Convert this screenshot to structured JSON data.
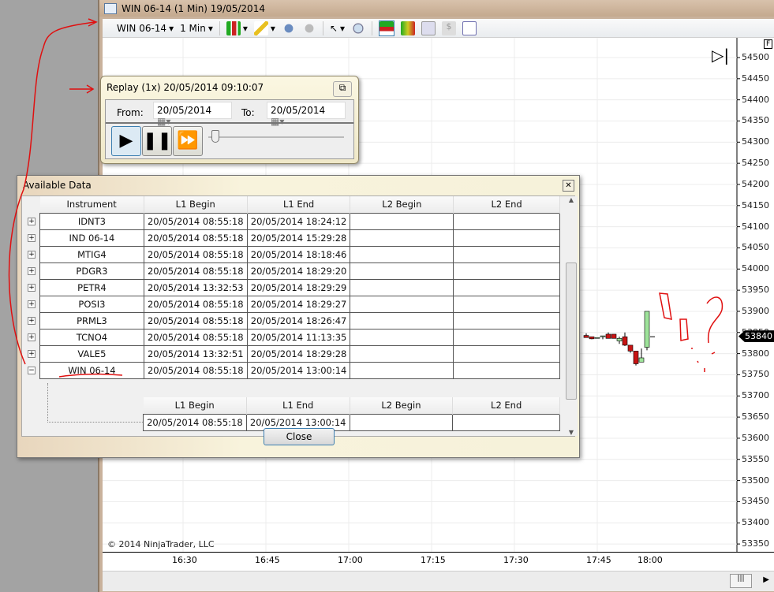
{
  "window": {
    "title": "WIN 06-14 (1 Min)  19/05/2014"
  },
  "toolbar": {
    "instrument": "WIN 06-14",
    "interval": "1 Min",
    "icons": [
      "bar-style-icon",
      "pencil-draw-icon",
      "add-indicator-icon",
      "remove-indicator-icon",
      "pointer-icon",
      "zoom-icon",
      "chart-trader-icon",
      "strategy-icon",
      "data-box-icon",
      "dollar-icon",
      "properties-icon"
    ]
  },
  "chart": {
    "badge": "F",
    "price_labels": [
      "54500",
      "54450",
      "54400",
      "54350",
      "54300",
      "54250",
      "54200",
      "54150",
      "54100",
      "54050",
      "54000",
      "53950",
      "53900",
      "53850",
      "53800",
      "53750",
      "53700",
      "53650",
      "53600",
      "53550",
      "53500",
      "53450",
      "53400",
      "53350"
    ],
    "current_price": "53840",
    "time_labels": [
      "16:30",
      "16:45",
      "17:00",
      "17:15",
      "17:30",
      "17:45",
      "18:00"
    ],
    "copyright": "© 2014 NinjaTrader, LLC",
    "up_color": "#9ee39a",
    "down_color": "#c81414",
    "candles": [
      {
        "o": 53843,
        "h": 53848,
        "l": 53838,
        "c": 53838
      },
      {
        "o": 53840,
        "h": 53840,
        "l": 53834,
        "c": 53835
      },
      {
        "o": 53838,
        "h": 53838,
        "l": 53836,
        "c": 53838
      },
      {
        "o": 53840,
        "h": 53842,
        "l": 53834,
        "c": 53842
      },
      {
        "o": 53846,
        "h": 53850,
        "l": 53836,
        "c": 53836
      },
      {
        "o": 53846,
        "h": 53846,
        "l": 53836,
        "c": 53836
      },
      {
        "o": 53830,
        "h": 53840,
        "l": 53823,
        "c": 53836
      },
      {
        "o": 53840,
        "h": 53850,
        "l": 53818,
        "c": 53820
      },
      {
        "o": 53820,
        "h": 53820,
        "l": 53802,
        "c": 53806
      },
      {
        "o": 53806,
        "h": 53806,
        "l": 53772,
        "c": 53776
      },
      {
        "o": 53780,
        "h": 53812,
        "l": 53780,
        "c": 53790
      },
      {
        "o": 53815,
        "h": 53900,
        "l": 53808,
        "c": 53900
      }
    ]
  },
  "replay": {
    "title": "Replay (1x) 20/05/2014 09:10:07",
    "from_label": "From:",
    "from": "20/05/2014",
    "to_label": "To:",
    "to": "20/05/2014",
    "speed_fraction": 0.0
  },
  "available": {
    "title": "Available Data",
    "columns": [
      "Instrument",
      "L1 Begin",
      "L1 End",
      "L2 Begin",
      "L2 End"
    ],
    "rows": [
      [
        "IDNT3",
        "20/05/2014 08:55:18",
        "20/05/2014 18:24:12",
        "",
        ""
      ],
      [
        "IND 06-14",
        "20/05/2014 08:55:18",
        "20/05/2014 15:29:28",
        "",
        ""
      ],
      [
        "MTIG4",
        "20/05/2014 08:55:18",
        "20/05/2014 18:18:46",
        "",
        ""
      ],
      [
        "PDGR3",
        "20/05/2014 08:55:18",
        "20/05/2014 18:29:20",
        "",
        ""
      ],
      [
        "PETR4",
        "20/05/2014 13:32:53",
        "20/05/2014 18:29:29",
        "",
        ""
      ],
      [
        "POSI3",
        "20/05/2014 08:55:18",
        "20/05/2014 18:29:27",
        "",
        ""
      ],
      [
        "PRML3",
        "20/05/2014 08:55:18",
        "20/05/2014 18:26:47",
        "",
        ""
      ],
      [
        "TCNO4",
        "20/05/2014 08:55:18",
        "20/05/2014 11:13:35",
        "",
        ""
      ],
      [
        "VALE5",
        "20/05/2014 13:32:51",
        "20/05/2014 18:29:28",
        "",
        ""
      ],
      [
        "WIN 06-14",
        "20/05/2014 08:55:18",
        "20/05/2014 13:00:14",
        "",
        ""
      ]
    ],
    "sub_columns": [
      "L1 Begin",
      "L1 End",
      "L2 Begin",
      "L2 End"
    ],
    "sub_row": [
      "20/05/2014 08:55:18",
      "20/05/2014 13:00:14",
      "",
      ""
    ],
    "close": "Close"
  }
}
